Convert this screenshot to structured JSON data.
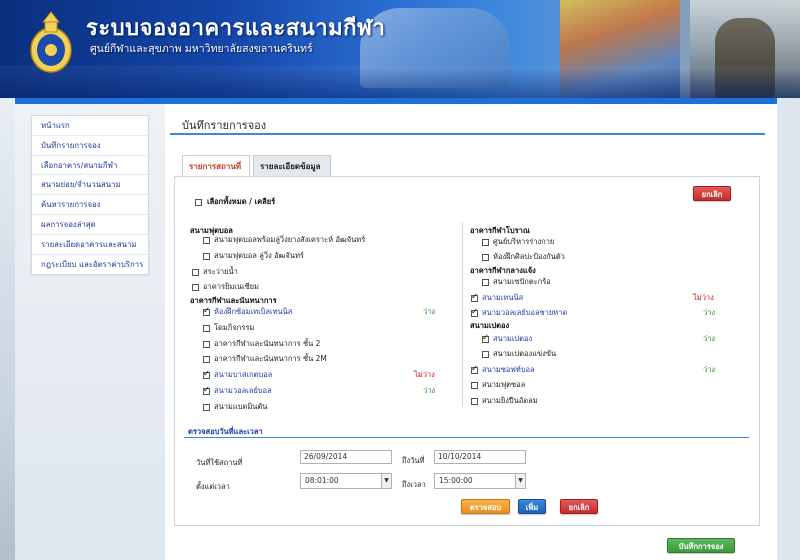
{
  "header": {
    "title": "ระบบจองอาคารและสนามกีฬา",
    "subtitle": "ศูนย์กีฬาและสุขภาพ มหาวิทยาลัยสงขลานครินทร์"
  },
  "sidebar": {
    "items": [
      {
        "label": "หน้าแรก"
      },
      {
        "label": "บันทึกรายการจอง"
      },
      {
        "label": "เลือกอาคาร/สนามกีฬา"
      },
      {
        "label": "สนามย่อย/จำนวนสนาม"
      },
      {
        "label": "ค้นหารายการจอง"
      },
      {
        "label": "ผลการจองล่าสุด"
      },
      {
        "label": "รายละเอียดอาคารและสนาม"
      },
      {
        "label": "กฎระเบียบ และอัตราค่าบริการ"
      }
    ]
  },
  "page": {
    "title": "บันทึกรายการจอง"
  },
  "tabs": [
    {
      "label": "รายการสถานที่",
      "active": true
    },
    {
      "label": "รายละเอียดข้อมูล",
      "active": false
    }
  ],
  "select_all": {
    "label": "เลือกทั้งหมด / เคลียร์",
    "checked": false
  },
  "cancel_top": "ยกเลิก",
  "left_groups": {
    "football": {
      "title": "สนามฟุตบอล",
      "items": [
        {
          "label": "สนามฟุตบอลพร้อมลู่วิ่งยางสังเคราะห์ อัฒจันทร์",
          "checked": false
        },
        {
          "label": "สนามฟุตบอล ลู่วิ่ง อัฒจันทร์",
          "checked": false
        }
      ]
    },
    "pool": {
      "label": "สระว่ายน้ำ",
      "checked": false
    },
    "gym": {
      "label": "อาคารยิมเนเซียม",
      "checked": false
    },
    "activity": {
      "title": "อาคารกีฬาและนันทนาการ",
      "items": [
        {
          "label": "ห้องฝึกซ้อมเทเบิลเทนนิส",
          "checked": true,
          "status": "ว่าง"
        },
        {
          "label": "โดมกิจกรรม",
          "checked": false,
          "status": ""
        },
        {
          "label": "อาคารกีฬาและนันทนาการ ชั้น 2",
          "checked": false,
          "status": ""
        },
        {
          "label": "อาคารกีฬาและนันทนาการ ชั้น 2M",
          "checked": false,
          "status": ""
        },
        {
          "label": "สนามบาสเกตบอล",
          "checked": true,
          "status": "ไม่ว่าง"
        },
        {
          "label": "สนามวอลเลย์บอล",
          "checked": true,
          "status": "ว่าง"
        },
        {
          "label": "สนามแบดมินตัน",
          "checked": false,
          "status": ""
        }
      ]
    }
  },
  "right_groups": {
    "ibrahim": {
      "title": "อาคารกีฬาโบราณ",
      "items": [
        {
          "label": "ศูนย์บริหารร่างกาย",
          "checked": false
        },
        {
          "label": "ห้องฝึกศิลปะป้องกันตัว",
          "checked": false
        }
      ]
    },
    "outdoor": {
      "title": "อาคารกีฬากลางแจ้ง",
      "items": [
        {
          "label": "สนามเซปักตะกร้อ",
          "checked": false
        }
      ]
    },
    "tennis": {
      "label": "สนามเทนนิส",
      "checked": true,
      "status": "ไม่ว่าง"
    },
    "beach": {
      "label": "สนามวอลเลย์บอลชายหาด",
      "checked": true,
      "status": "ว่าง"
    },
    "petanque": {
      "title": "สนามเปตอง",
      "items": [
        {
          "label": "สนามเปตอง",
          "checked": true,
          "status": "ว่าง"
        },
        {
          "label": "สนามเปตองแข่งขัน",
          "checked": false,
          "status": ""
        }
      ]
    },
    "softball": {
      "label": "สนามซอฟท์บอล",
      "checked": true,
      "status": "ว่าง"
    },
    "football2": {
      "label": "สนามฟุตซอล",
      "checked": false
    },
    "archery": {
      "label": "สนามยิงปืนอัดลม",
      "checked": false
    }
  },
  "check_section": {
    "title": "ตรวจสอบวันที่และเวลา",
    "start_date_label": "วันที่ใช้สถานที่",
    "start_date": "26/09/2014",
    "end_date_label": "ถึงวันที่",
    "end_date": "10/10/2014",
    "start_time_label": "ตั้งแต่เวลา",
    "start_time": "08:01:00",
    "end_time_label": "ถึงเวลา",
    "end_time": "15:00:00",
    "check_button": "ตรวจสอบ",
    "add_button": "เพิ่ม",
    "cancel_button": "ยกเลิก"
  },
  "save_button": "บันทึกการจอง",
  "colors": {
    "accent": "#1f6fd8",
    "available": "#1c8a1c",
    "unavailable": "#d01010",
    "link": "#1f3aa8"
  }
}
